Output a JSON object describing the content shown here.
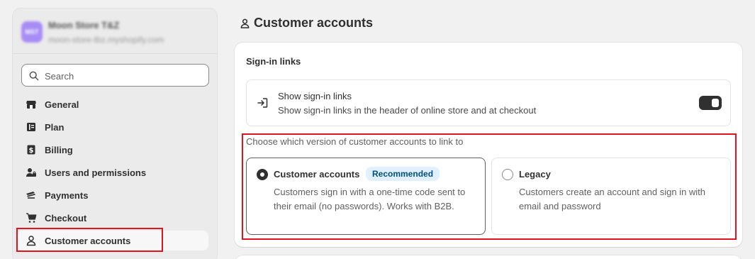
{
  "store": {
    "avatar": "MST",
    "name": "Moon Store T&Z",
    "url": "moon-store-tbz.myshopify.com"
  },
  "search": {
    "placeholder": "Search"
  },
  "nav": [
    {
      "label": "General",
      "icon": "store-icon"
    },
    {
      "label": "Plan",
      "icon": "plan-icon"
    },
    {
      "label": "Billing",
      "icon": "billing-icon"
    },
    {
      "label": "Users and permissions",
      "icon": "users-icon"
    },
    {
      "label": "Payments",
      "icon": "payments-icon"
    },
    {
      "label": "Checkout",
      "icon": "cart-icon"
    },
    {
      "label": "Customer accounts",
      "icon": "person-icon",
      "active": true
    }
  ],
  "page": {
    "title": "Customer accounts"
  },
  "card": {
    "title": "Sign-in links",
    "signin": {
      "title": "Show sign-in links",
      "description": "Show sign-in links in the header of online store and at checkout",
      "enabled": true
    },
    "choose_label": "Choose which version of customer accounts to link to",
    "options": [
      {
        "title": "Customer accounts",
        "badge": "Recommended",
        "description": "Customers sign in with a one-time code sent to their email (no passwords). Works with B2B.",
        "selected": true
      },
      {
        "title": "Legacy",
        "description": "Customers create an account and sign in with email and password",
        "selected": false
      }
    ]
  },
  "colors": {
    "highlight": "#e0141e",
    "badge_bg": "#e0f0ff",
    "badge_text": "#00527c",
    "toggle_on": "#303030"
  }
}
